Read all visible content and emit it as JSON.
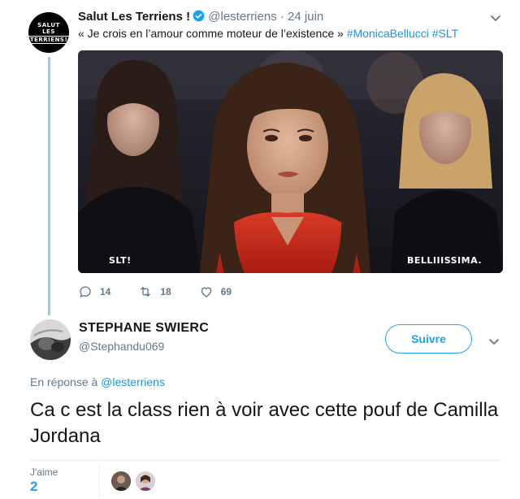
{
  "tweet": {
    "avatar_text": [
      "SALUT",
      "LES",
      "TERRIENS!"
    ],
    "name": "Salut Les Terriens !",
    "handle": "@lesterriens",
    "separator": "·",
    "date": "24 juin",
    "text_prefix": "« Je crois en l’amour comme moteur de l’existence » ",
    "hashtags": [
      "#MonicaBellucci",
      "#SLT"
    ],
    "media_captions": {
      "left": "SLT!",
      "right": "BELLIIISSIMA."
    },
    "replies": "14",
    "retweets": "18",
    "likes": "69"
  },
  "reply": {
    "name": "STEPHANE SWIERC",
    "handle": "@Stephandu069",
    "follow_label": "Suivre",
    "reply_prefix": "En réponse à ",
    "reply_mention": "@lesterriens",
    "text": "Ca c est la class rien à voir avec cette pouf de Camilla Jordana",
    "likes_label": "J'aime",
    "likes_count": "2"
  },
  "colors": {
    "blue": "#1da1f2",
    "link": "#1b95e0",
    "gray": "#657786",
    "thread": "#8ad1f5"
  },
  "icons": [
    "verified-badge-icon",
    "chevron-down-icon",
    "reply-icon",
    "retweet-icon",
    "heart-icon"
  ]
}
